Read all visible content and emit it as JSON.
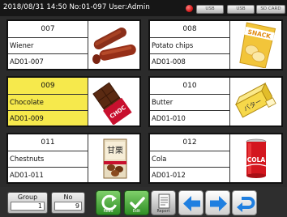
{
  "header": {
    "status_text": "2018/08/31  14:50  No:01-097   User:Admin",
    "usb_labels": [
      "USB",
      "USB",
      "SD CARD"
    ]
  },
  "products": [
    {
      "number": "007",
      "name": "Wiener",
      "code": "AD01-007",
      "selected": false,
      "icon": "sausage-icon"
    },
    {
      "number": "008",
      "name": "Potato chips",
      "code": "AD01-008",
      "selected": false,
      "icon": "chips-bag-icon",
      "image_text": "SNACK"
    },
    {
      "number": "009",
      "name": "Chocolate",
      "code": "AD01-009",
      "selected": true,
      "icon": "chocolate-icon",
      "image_text": "CHOC"
    },
    {
      "number": "010",
      "name": "Butter",
      "code": "AD01-010",
      "selected": false,
      "icon": "butter-icon",
      "image_text": "バター"
    },
    {
      "number": "011",
      "name": "Chestnuts",
      "code": "AD01-011",
      "selected": false,
      "icon": "chestnut-bag-icon",
      "image_text": "甘栗"
    },
    {
      "number": "012",
      "name": "Cola",
      "code": "AD01-012",
      "selected": false,
      "icon": "cola-can-icon",
      "image_text": "COLA"
    }
  ],
  "footer": {
    "group": {
      "label": "Group",
      "value": "1"
    },
    "no": {
      "label": "No",
      "value": "9"
    },
    "buttons": {
      "read": "Read",
      "edit": "Edit",
      "report": "Report"
    }
  },
  "colors": {
    "selected": "#f6e94c",
    "header_bg": "#161616",
    "screen_bg": "#2b2b2b"
  }
}
